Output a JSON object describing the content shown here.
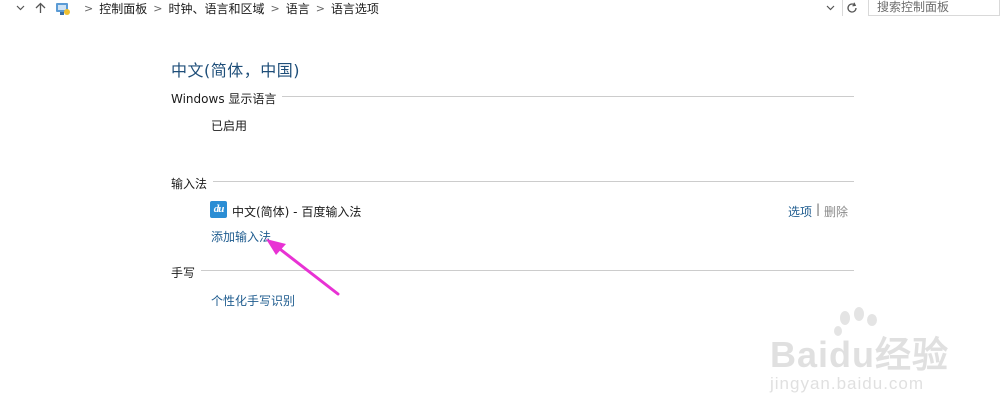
{
  "addressbar": {
    "crumbs": [
      "控制面板",
      "时钟、语言和区域",
      "语言",
      "语言选项"
    ],
    "search_placeholder": "搜索控制面板"
  },
  "page": {
    "title": "中文(简体，中国)"
  },
  "display_language": {
    "label": "Windows 显示语言",
    "status": "已启用"
  },
  "input_method": {
    "label": "输入法",
    "ime_logo_text": "du",
    "ime_name": "中文(简体) - 百度输入法",
    "options_link": "选项",
    "separator": "|",
    "remove_link": "删除",
    "add_link": "添加输入法"
  },
  "handwriting": {
    "label": "手写",
    "personalize_link": "个性化手写识别"
  },
  "watermark": {
    "brand": "Baidu经验",
    "url": "jingyan.baidu.com"
  },
  "colors": {
    "title": "#1e4e79",
    "link": "#1f5c8f",
    "arrow": "#e832d4",
    "ime_logo": "#2a8dd4"
  }
}
